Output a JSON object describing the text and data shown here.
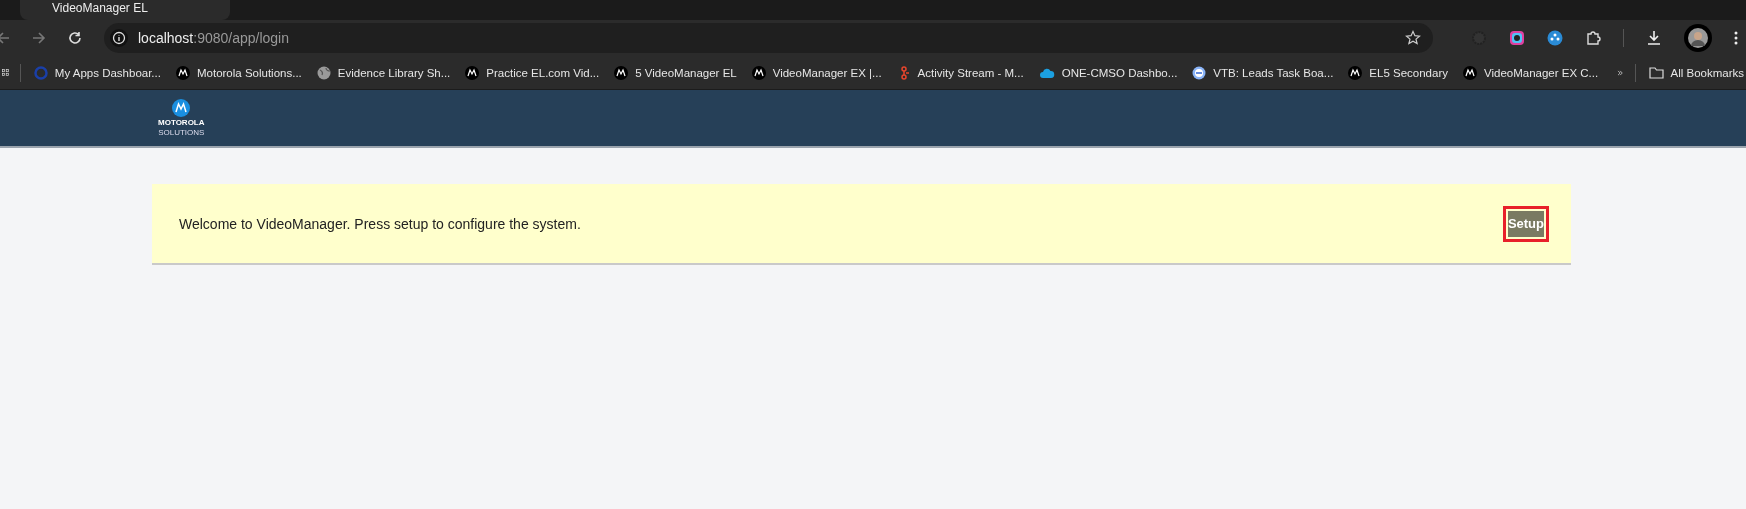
{
  "browser": {
    "tab_title": "VideoManager EL",
    "url_host": "localhost",
    "url_path": ":9080/app/login",
    "bookmarks": [
      {
        "label": "My Apps Dashboar...",
        "kind": "ring"
      },
      {
        "label": "Motorola Solutions...",
        "kind": "motorola"
      },
      {
        "label": "Evidence Library Sh...",
        "kind": "globe"
      },
      {
        "label": "Practice EL.com Vid...",
        "kind": "motorola"
      },
      {
        "label": "5 VideoManager EL",
        "kind": "motorola"
      },
      {
        "label": "VideoManager EX |...",
        "kind": "motorola"
      },
      {
        "label": "Activity Stream - M...",
        "kind": "branch"
      },
      {
        "label": "ONE-CMSO Dashbo...",
        "kind": "cloud"
      },
      {
        "label": "VTB: Leads Task Boa...",
        "kind": "badge"
      },
      {
        "label": "EL5 Secondary",
        "kind": "motorola"
      },
      {
        "label": "VideoManager EX C...",
        "kind": "motorola"
      }
    ],
    "all_bookmarks": "All Bookmarks"
  },
  "header": {
    "logo_line_1": "MOTOROLA",
    "logo_line_2": "SOLUTIONS"
  },
  "banner": {
    "message": "Welcome to VideoManager. Press setup to configure the system.",
    "button": "Setup",
    "button_highlighted": true
  }
}
